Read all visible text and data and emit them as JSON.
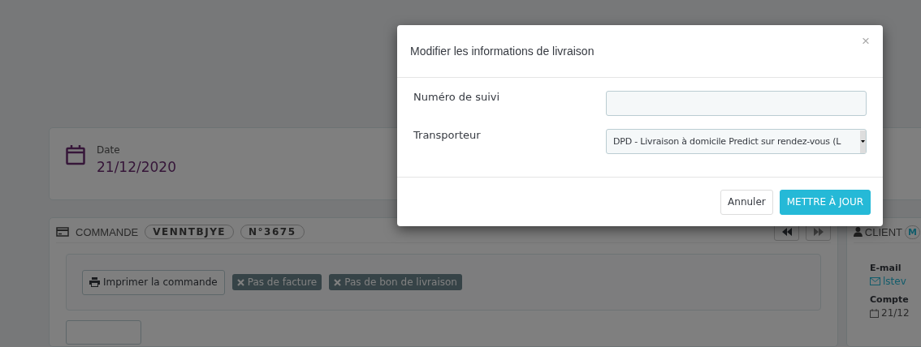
{
  "date_card": {
    "label": "Date",
    "value": "21/12/2020"
  },
  "order_panel": {
    "title": "COMMANDE",
    "badges": [
      "VENNTBJYE",
      "N°3675"
    ],
    "print_button": "Imprimer la commande",
    "status_tags": [
      "Pas de facture",
      "Pas de bon de livraison"
    ]
  },
  "client_panel": {
    "title": "CLIENT",
    "badge": "M",
    "email_label": "E-mail",
    "email": "lstev",
    "account_label": "Compte",
    "account_date": "21/12"
  },
  "modal": {
    "title": "Modifier les informations de livraison",
    "close": "×",
    "fields": [
      {
        "label": "Numéro de suivi",
        "kind": "text"
      },
      {
        "label": "Transporteur",
        "kind": "select",
        "value": "DPD - Livraison à domicile Predict sur rendez-vous (L"
      }
    ],
    "buttons": [
      {
        "label": "Annuler",
        "kind": "secondary"
      },
      {
        "label": "METTRE À JOUR",
        "kind": "primary"
      }
    ]
  }
}
